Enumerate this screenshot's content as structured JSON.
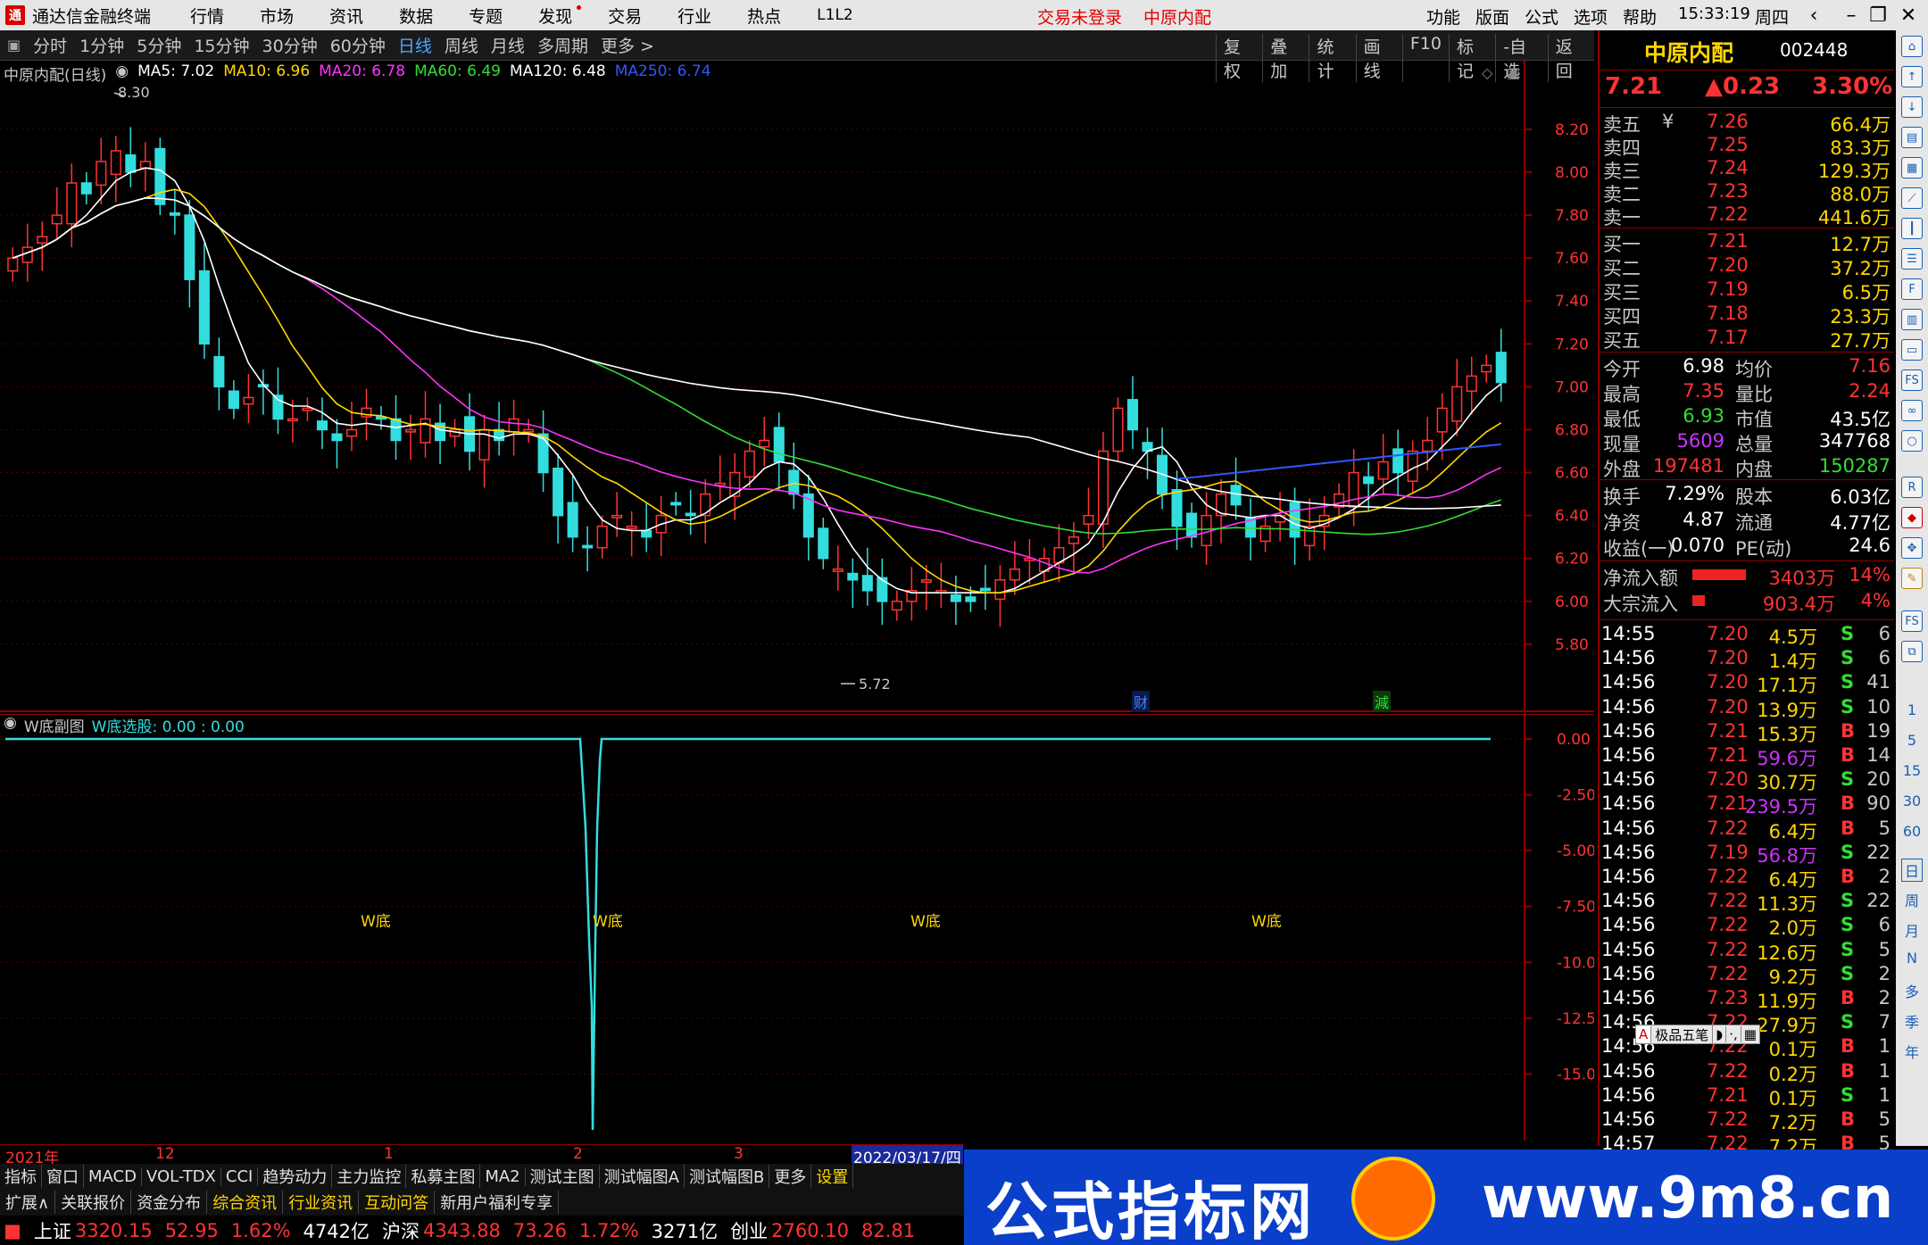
{
  "app": {
    "name": "通达信金融终端",
    "menu": [
      "行情",
      "市场",
      "资讯",
      "数据",
      "专题",
      "发现",
      "交易",
      "行业",
      "热点",
      "L1L2"
    ],
    "status_trade": "交易未登录",
    "status_broker": "中原内配",
    "right_menu": [
      "功能",
      "版面",
      "公式",
      "选项",
      "帮助"
    ],
    "time": "15:33:19",
    "weekday": "周四"
  },
  "toolbar": {
    "periods": [
      "分时",
      "1分钟",
      "5分钟",
      "15分钟",
      "30分钟",
      "60分钟",
      "日线",
      "周线",
      "月线",
      "多周期",
      "更多 >"
    ],
    "active_period": "日线",
    "actions": [
      "复权",
      "叠加",
      "统计",
      "画线",
      "F10",
      "标记",
      "-自选",
      "返回"
    ]
  },
  "main_chart": {
    "title": "中原内配(日线)",
    "ma_legend": [
      {
        "label": "MA5: 7.02",
        "color": "#ffffff"
      },
      {
        "label": "MA10: 6.96",
        "color": "#ffd700"
      },
      {
        "label": "MA20: 6.78",
        "color": "#ff33ff"
      },
      {
        "label": "MA60: 6.49",
        "color": "#33dd33"
      },
      {
        "label": "MA120: 6.48",
        "color": "#ffffff"
      },
      {
        "label": "MA250: 6.74",
        "color": "#3355ff"
      }
    ],
    "high_marker": "8.30",
    "low_marker": "5.72",
    "event_labels": [
      "财",
      "減"
    ],
    "price_ticks": [
      "8.20",
      "8.00",
      "7.80",
      "7.60",
      "7.40",
      "7.20",
      "7.00",
      "6.80",
      "6.60",
      "6.40",
      "6.20",
      "6.00",
      "5.80"
    ]
  },
  "chart_data": {
    "type": "candlestick",
    "y_range": [
      5.72,
      8.3
    ],
    "series": [
      {
        "name": "MA5",
        "color": "#ffffff"
      },
      {
        "name": "MA10",
        "color": "#ffd700"
      },
      {
        "name": "MA20",
        "color": "#ff33ff"
      },
      {
        "name": "MA60",
        "color": "#33dd33"
      },
      {
        "name": "MA120",
        "color": "#ffffff"
      },
      {
        "name": "MA250",
        "color": "#3355ff"
      }
    ],
    "closes": [
      7.6,
      7.65,
      7.7,
      7.8,
      7.95,
      7.9,
      8.05,
      8.1,
      8.0,
      8.05,
      7.85,
      7.8,
      7.5,
      7.2,
      7.0,
      6.9,
      6.95,
      7.0,
      6.85,
      6.85,
      6.9,
      6.8,
      6.75,
      6.8,
      6.9,
      6.85,
      6.75,
      6.8,
      6.85,
      6.75,
      6.8,
      6.7,
      6.8,
      6.75,
      6.85,
      6.8,
      6.6,
      6.4,
      6.3,
      6.25,
      6.35,
      6.4,
      6.35,
      6.3,
      6.4,
      6.45,
      6.4,
      6.5,
      6.55,
      6.6,
      6.7,
      6.75,
      6.65,
      6.5,
      6.3,
      6.2,
      6.15,
      6.1,
      6.05,
      6.0,
      6.0,
      6.05,
      6.1,
      6.05,
      6.0,
      6.0,
      6.05,
      6.1,
      6.15,
      6.2,
      6.2,
      6.25,
      6.3,
      6.4,
      6.7,
      6.9,
      6.8,
      6.7,
      6.5,
      6.35,
      6.3,
      6.4,
      6.5,
      6.45,
      6.3,
      6.35,
      6.4,
      6.3,
      6.35,
      6.4,
      6.5,
      6.6,
      6.55,
      6.65,
      6.6,
      6.7,
      6.75,
      6.9,
      7.0,
      7.05,
      7.1,
      7.02
    ],
    "sub_title": "W底副图",
    "sub_legend": "W底选股: 0.00 : 0.00",
    "sub_ticks": [
      "0.00",
      "-2.50",
      "-5.00",
      "-7.50",
      "-10.00",
      "-12.50",
      "-15.00"
    ],
    "sub_spike_min": -17.5,
    "w_labels": [
      "W底",
      "W底",
      "W底",
      "W底"
    ]
  },
  "quote": {
    "name": "中原内配",
    "code": "002448",
    "price": "7.21",
    "change": "▲0.23",
    "pct": "3.30%",
    "asks": [
      {
        "label": "卖五",
        "sym": "¥",
        "price": "7.26",
        "vol": "66.4万"
      },
      {
        "label": "卖四",
        "sym": "",
        "price": "7.25",
        "vol": "83.3万"
      },
      {
        "label": "卖三",
        "sym": "",
        "price": "7.24",
        "vol": "129.3万"
      },
      {
        "label": "卖二",
        "sym": "",
        "price": "7.23",
        "vol": "88.0万"
      },
      {
        "label": "卖一",
        "sym": "",
        "price": "7.22",
        "vol": "441.6万"
      }
    ],
    "bids": [
      {
        "label": "买一",
        "price": "7.21",
        "vol": "12.7万"
      },
      {
        "label": "买二",
        "price": "7.20",
        "vol": "37.2万"
      },
      {
        "label": "买三",
        "price": "7.19",
        "vol": "6.5万"
      },
      {
        "label": "买四",
        "price": "7.18",
        "vol": "23.3万"
      },
      {
        "label": "买五",
        "price": "7.17",
        "vol": "27.7万"
      }
    ],
    "stats": [
      {
        "k1": "今开",
        "v1": "6.98",
        "c1": "#ffffff",
        "k2": "均价",
        "v2": "7.16",
        "c2": "#ff3333"
      },
      {
        "k1": "最高",
        "v1": "7.35",
        "c1": "#ff3333",
        "k2": "量比",
        "v2": "2.24",
        "c2": "#ff3333"
      },
      {
        "k1": "最低",
        "v1": "6.93",
        "c1": "#33dd33",
        "k2": "市值",
        "v2": "43.5亿",
        "c2": "#ffffff"
      },
      {
        "k1": "现量",
        "v1": "5609",
        "c1": "#cc33ff",
        "k2": "总量",
        "v2": "347768",
        "c2": "#ffffff"
      },
      {
        "k1": "外盘",
        "v1": "197481",
        "c1": "#ff3333",
        "k2": "内盘",
        "v2": "150287",
        "c2": "#33dd33"
      }
    ],
    "stats2": [
      {
        "k1": "换手",
        "v1": "7.29%",
        "k2": "股本",
        "v2": "6.03亿"
      },
      {
        "k1": "净资",
        "v1": "4.87",
        "k2": "流通",
        "v2": "4.77亿"
      },
      {
        "k1": "收益(一)",
        "v1": "0.070",
        "k2": "PE(动)",
        "v2": "24.6"
      }
    ],
    "flows": [
      {
        "label": "净流入额",
        "value": "3403万",
        "pct": "14%",
        "bar": 0.85
      },
      {
        "label": "大宗流入",
        "value": "903.4万",
        "pct": "4%",
        "bar": 0.2
      }
    ],
    "ticks": [
      {
        "t": "14:55",
        "p": "7.20",
        "v": "4.5万",
        "bs": "S",
        "n": "6",
        "vc": "#ffd700"
      },
      {
        "t": "14:56",
        "p": "7.20",
        "v": "1.4万",
        "bs": "S",
        "n": "6",
        "vc": "#ffd700"
      },
      {
        "t": "14:56",
        "p": "7.20",
        "v": "17.1万",
        "bs": "S",
        "n": "41",
        "vc": "#ffd700"
      },
      {
        "t": "14:56",
        "p": "7.20",
        "v": "13.9万",
        "bs": "S",
        "n": "10",
        "vc": "#ffd700"
      },
      {
        "t": "14:56",
        "p": "7.21",
        "v": "15.3万",
        "bs": "B",
        "n": "19",
        "vc": "#ffd700"
      },
      {
        "t": "14:56",
        "p": "7.21",
        "v": "59.6万",
        "bs": "B",
        "n": "14",
        "vc": "#cc33ff"
      },
      {
        "t": "14:56",
        "p": "7.20",
        "v": "30.7万",
        "bs": "S",
        "n": "20",
        "vc": "#ffd700"
      },
      {
        "t": "14:56",
        "p": "7.21",
        "v": "239.5万",
        "bs": "B",
        "n": "90",
        "vc": "#cc33ff"
      },
      {
        "t": "14:56",
        "p": "7.22",
        "v": "6.4万",
        "bs": "B",
        "n": "5",
        "vc": "#ffd700"
      },
      {
        "t": "14:56",
        "p": "7.19",
        "v": "56.8万",
        "bs": "S",
        "n": "22",
        "vc": "#cc33ff"
      },
      {
        "t": "14:56",
        "p": "7.22",
        "v": "6.4万",
        "bs": "B",
        "n": "2",
        "vc": "#ffd700"
      },
      {
        "t": "14:56",
        "p": "7.22",
        "v": "11.3万",
        "bs": "S",
        "n": "22",
        "vc": "#ffd700"
      },
      {
        "t": "14:56",
        "p": "7.22",
        "v": "2.0万",
        "bs": "S",
        "n": "6",
        "vc": "#ffd700"
      },
      {
        "t": "14:56",
        "p": "7.22",
        "v": "12.6万",
        "bs": "S",
        "n": "5",
        "vc": "#ffd700"
      },
      {
        "t": "14:56",
        "p": "7.22",
        "v": "9.2万",
        "bs": "S",
        "n": "2",
        "vc": "#ffd700"
      },
      {
        "t": "14:56",
        "p": "7.23",
        "v": "11.9万",
        "bs": "B",
        "n": "2",
        "vc": "#ffd700"
      },
      {
        "t": "14:56",
        "p": "7.22",
        "v": "27.9万",
        "bs": "S",
        "n": "7",
        "vc": "#ffd700"
      },
      {
        "t": "14:56",
        "p": "7.22",
        "v": "0.1万",
        "bs": "B",
        "n": "1",
        "vc": "#ffd700"
      },
      {
        "t": "14:56",
        "p": "7.22",
        "v": "0.2万",
        "bs": "B",
        "n": "1",
        "vc": "#ffd700"
      },
      {
        "t": "14:56",
        "p": "7.21",
        "v": "0.1万",
        "bs": "S",
        "n": "1",
        "vc": "#ffd700"
      },
      {
        "t": "14:56",
        "p": "7.22",
        "v": "7.2万",
        "bs": "B",
        "n": "5",
        "vc": "#ffd700"
      },
      {
        "t": "14:57",
        "p": "7.22",
        "v": "7.2万",
        "bs": "B",
        "n": "5",
        "vc": "#ffd700"
      }
    ],
    "ime_label": "极品五笔"
  },
  "side_icons": [
    "日",
    "周",
    "月",
    "N",
    "多",
    "季",
    "年"
  ],
  "side_numbers": [
    "1",
    "5",
    "15",
    "30",
    "60"
  ],
  "date_axis": {
    "labels": [
      "2021年",
      "12",
      "1",
      "2",
      "3"
    ],
    "cursor": "2022/03/17/四"
  },
  "bottom_tabs1": [
    "指标",
    "窗口",
    "MACD",
    "VOL-TDX",
    "CCI",
    "趋势动力",
    "主力监控",
    "私募主图",
    "MA2",
    "测试主图",
    "测试幅图A",
    "测试幅图B",
    "更多",
    "设置"
  ],
  "bottom_tabs2": [
    "扩展∧",
    "关联报价",
    "资金分布",
    "综合资讯",
    "行业资讯",
    "互动问答",
    "新用户福利专享"
  ],
  "index_bar": [
    {
      "name": "上证",
      "val": "3320.15",
      "chg": "52.95",
      "pct": "1.62%",
      "amt": "4742亿"
    },
    {
      "name": "沪深",
      "val": "4343.88",
      "chg": "73.26",
      "pct": "1.72%",
      "amt": "3271亿"
    },
    {
      "name": "创业",
      "val": "2760.10",
      "chg": "82.81"
    }
  ],
  "watermark": {
    "left": "公式指标网",
    "right": "www.9m8.cn"
  }
}
